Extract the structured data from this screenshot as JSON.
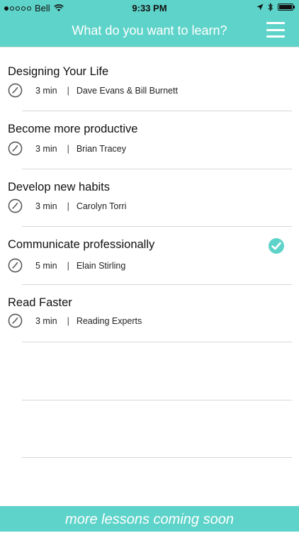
{
  "status_bar": {
    "carrier": "Bell",
    "time": "9:33 PM"
  },
  "header": {
    "title": "What do you want to learn?",
    "menu_icon": "hamburger-menu-icon"
  },
  "lessons": [
    {
      "title": "Designing Your Life",
      "duration": "3 min",
      "separator": "|",
      "author": "Dave Evans & Bill Burnett",
      "selected": false
    },
    {
      "title": "Become more productive",
      "duration": "3 min",
      "separator": "|",
      "author": "Brian Tracey",
      "selected": false
    },
    {
      "title": "Develop new habits",
      "duration": "3 min",
      "separator": "|",
      "author": "Carolyn Torri",
      "selected": false
    },
    {
      "title": "Communicate professionally",
      "duration": "5 min",
      "separator": "|",
      "author": "Elain Stirling",
      "selected": true
    },
    {
      "title": "Read Faster",
      "duration": "3 min",
      "separator": "|",
      "author": "Reading Experts",
      "selected": false
    }
  ],
  "footer": {
    "text": "more lessons coming soon"
  },
  "colors": {
    "accent": "#5ed3c9",
    "divider": "#d7d7d7"
  }
}
